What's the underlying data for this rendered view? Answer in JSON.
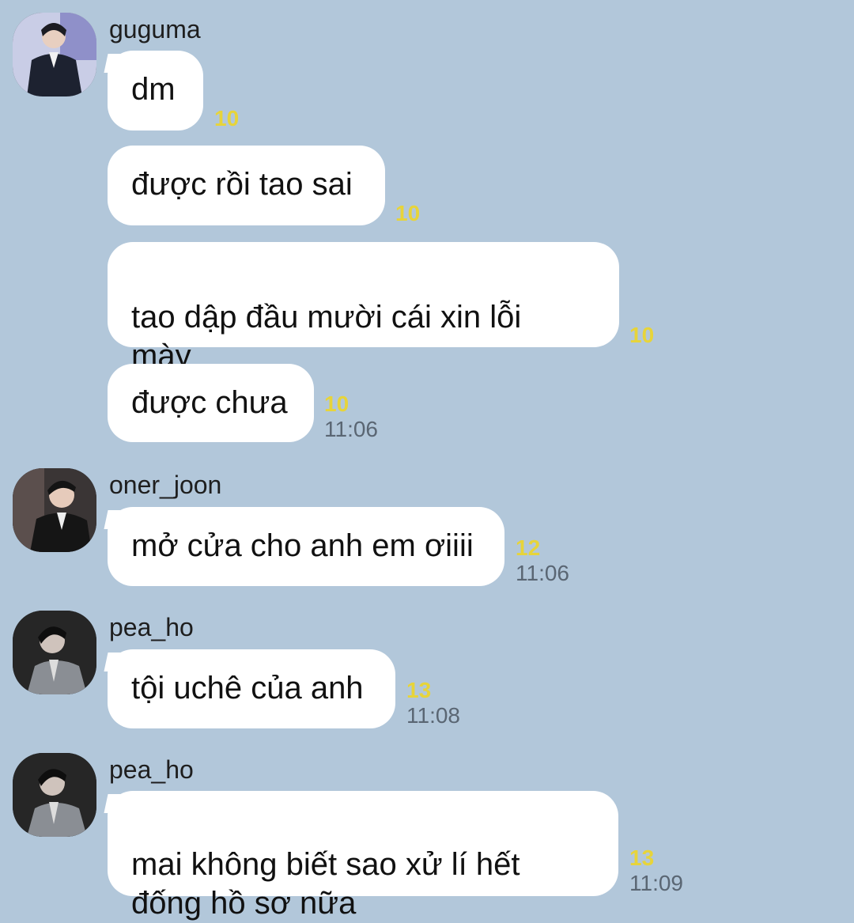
{
  "messages": [
    {
      "sender": "guguma",
      "avatar": "guguma-avatar",
      "bubbles": [
        {
          "text": "dm",
          "unread": "10",
          "time": ""
        },
        {
          "text": "được rồi tao sai",
          "unread": "10",
          "time": ""
        },
        {
          "text": "tao dập đầu mười cái xin lỗi\nmày",
          "unread": "10",
          "time": ""
        },
        {
          "text": "được chưa",
          "unread": "10",
          "time": "11:06"
        }
      ]
    },
    {
      "sender": "oner_joon",
      "avatar": "oner-joon-avatar",
      "bubbles": [
        {
          "text": "mở cửa cho anh em ơiiii",
          "unread": "12",
          "time": "11:06"
        }
      ]
    },
    {
      "sender": "pea_ho",
      "avatar": "pea-ho-avatar",
      "bubbles": [
        {
          "text": "tội uchê của anh",
          "unread": "13",
          "time": "11:08"
        }
      ]
    },
    {
      "sender": "pea_ho",
      "avatar": "pea-ho-avatar",
      "bubbles": [
        {
          "text": "mai không biết sao xử lí hết\nđống hồ sơ nữa",
          "unread": "13",
          "time": "11:09"
        }
      ]
    }
  ],
  "colors": {
    "background": "#b2c7da",
    "bubble": "#ffffff",
    "unread": "#e7d43a",
    "time": "#5a6673"
  }
}
